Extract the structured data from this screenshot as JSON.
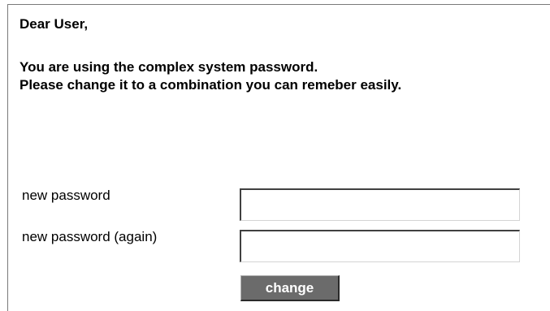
{
  "message": {
    "greeting": "Dear User,",
    "line1": "You are using the complex system password.",
    "line2": "Please change it to a combination you can remeber easily."
  },
  "form": {
    "new_password_label": "new password",
    "new_password_value": "",
    "new_password_again_label": "new password (again)",
    "new_password_again_value": "",
    "change_button_label": "change"
  }
}
